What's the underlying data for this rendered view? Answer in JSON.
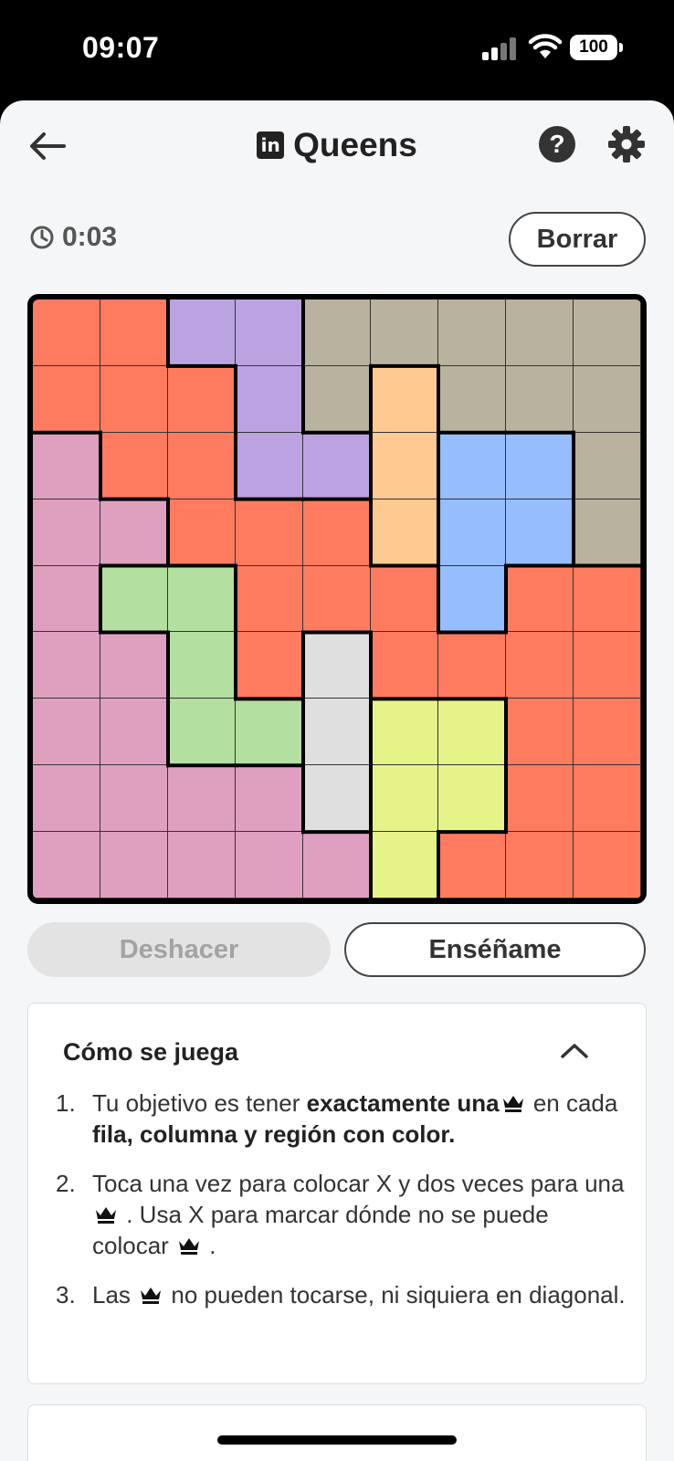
{
  "status_bar": {
    "time": "09:07",
    "battery": "100"
  },
  "header": {
    "title": "Queens",
    "logo_text": "in"
  },
  "timer": {
    "value": "0:03"
  },
  "buttons": {
    "clear": "Borrar",
    "undo": "Deshacer",
    "teach": "Enséñame"
  },
  "board": {
    "size": 9,
    "colors": {
      "A": "#ff7b60",
      "B": "#bba3e2",
      "C": "#b9b29e",
      "D": "#ffc992",
      "E": "#96bdfe",
      "F": "#dfa0bf",
      "G": "#b3dfa0",
      "H": "#dfdfdf",
      "I": "#e6f388"
    },
    "regions": [
      [
        "A",
        "A",
        "B",
        "B",
        "C",
        "C",
        "C",
        "C",
        "C"
      ],
      [
        "A",
        "A",
        "A",
        "B",
        "C",
        "D",
        "C",
        "C",
        "C"
      ],
      [
        "F",
        "A",
        "A",
        "B",
        "B",
        "D",
        "E",
        "E",
        "C"
      ],
      [
        "F",
        "F",
        "A",
        "A",
        "A",
        "D",
        "E",
        "E",
        "C"
      ],
      [
        "F",
        "G",
        "G",
        "A",
        "A",
        "A",
        "E",
        "A",
        "A"
      ],
      [
        "F",
        "F",
        "G",
        "A",
        "H",
        "A",
        "A",
        "A",
        "A"
      ],
      [
        "F",
        "F",
        "G",
        "G",
        "H",
        "I",
        "I",
        "A",
        "A"
      ],
      [
        "F",
        "F",
        "F",
        "F",
        "H",
        "I",
        "I",
        "A",
        "A"
      ],
      [
        "F",
        "F",
        "F",
        "F",
        "F",
        "I",
        "A",
        "A",
        "A"
      ]
    ]
  },
  "how_to_play": {
    "title": "Cómo se juega",
    "steps": [
      {
        "number": "1.",
        "text_1": "Tu objetivo es tener ",
        "bold_1": "exactamente una",
        "text_2": " en cada ",
        "bold_2": "fila, columna y región con color."
      },
      {
        "number": "2.",
        "text_1": "Toca una vez para colocar X y dos veces para una ",
        "text_2": " . Usa X para marcar dónde no se puede colocar ",
        "text_3": " ."
      },
      {
        "number": "3.",
        "text_1": "Las ",
        "text_2": " no pueden tocarse, ni siquiera en diagonal."
      }
    ]
  },
  "icons": [
    "back-arrow-icon",
    "linkedin-icon",
    "help-icon",
    "gear-icon",
    "clock-icon",
    "chevron-up-icon",
    "crown-icon",
    "signal-icon",
    "wifi-icon",
    "battery-icon"
  ]
}
